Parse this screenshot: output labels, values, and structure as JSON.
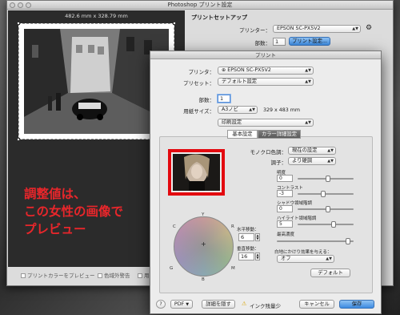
{
  "app": {
    "title": "Photoshop プリント設定"
  },
  "preview": {
    "dimensions": "482.6 mm x 328.79 mm",
    "note_lines": [
      "調整値は、",
      "この女性の画像で",
      "プレビュー"
    ],
    "options": [
      "プリントカラーをプレビュー",
      "色域外警告",
      "用"
    ]
  },
  "print_setup": {
    "header": "プリントセットアップ",
    "printer_label": "プリンター：",
    "printer_value": "EPSON SC-PX5V2",
    "copies_label": "部数：",
    "copies_value": "1",
    "settings_button": "プリント設定..."
  },
  "dialog": {
    "title": "プリント",
    "printer_label": "プリンタ：",
    "printer_value": "EPSON SC-PX5V2",
    "preset_label": "プリセット：",
    "preset_value": "デフォルト設定",
    "copies_label": "部数：",
    "copies_value": "1",
    "paper_label": "用紙サイズ：",
    "paper_value": "A3ノビ",
    "paper_dims": "329 x 483 mm",
    "section_value": "印刷設定",
    "tabs": [
      "基本設定",
      "カラー詳細設定"
    ],
    "mono_label": "モノクロ色調：",
    "mono_value": "現在の設定",
    "tone_label": "調子：",
    "tone_value": "より硬調",
    "adjustments": [
      {
        "label": "明度",
        "value": "0",
        "level": 0.55
      },
      {
        "label": "コントラスト",
        "value": "-3",
        "level": 0.45
      },
      {
        "label": "シャドウ領域階調",
        "value": "0",
        "level": 0.55
      },
      {
        "label": "ハイライト領域階調",
        "value": "5",
        "level": 0.65
      },
      {
        "label": "最高濃度",
        "value": "",
        "level": 0.95
      }
    ],
    "gloss_label": "白地にかけり効果を与える：",
    "gloss_value": "オフ",
    "default_button": "デフォルト",
    "wheel_labels": {
      "c": "C",
      "r": "R",
      "g": "G",
      "y": "Y",
      "b": "B",
      "m": "M"
    },
    "horizontal_label": "水平移動：",
    "horizontal_value": "6",
    "vertical_label": "垂直移動：",
    "vertical_value": "16",
    "help_button": "?",
    "pdf_button": "PDF",
    "hide_details_button": "詳細を隠す",
    "ink_warning": "インク残量少",
    "cancel_button": "キャンセル",
    "save_button": "保存"
  }
}
